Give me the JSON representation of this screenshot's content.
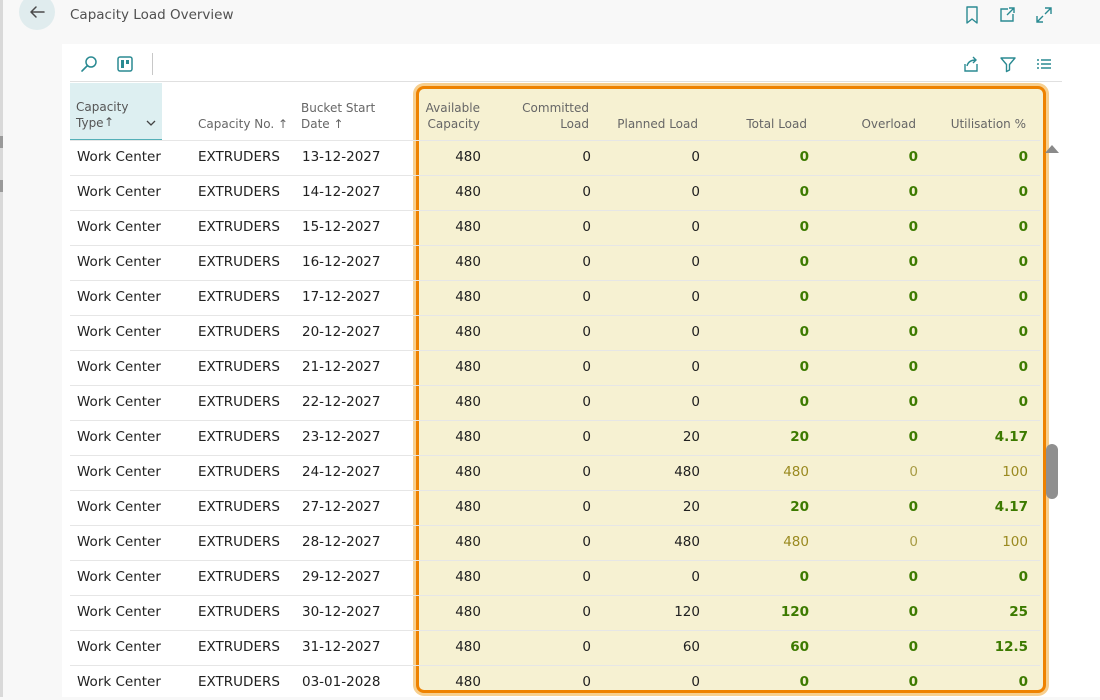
{
  "page": {
    "title": "Capacity Load Overview"
  },
  "header_icons": [
    "back-arrow-icon",
    "bookmark-icon",
    "open-new-window-icon",
    "expand-icon"
  ],
  "toolbar_icons": [
    "search-icon",
    "layout-icon",
    "share-icon",
    "filter-icon",
    "list-icon"
  ],
  "columns": {
    "cap_type": "Capacity Type",
    "cap_type_sort": "↑",
    "cap_no": "Capacity No.",
    "cap_no_sort": "↑",
    "bucket_line1": "Bucket Start",
    "bucket_line2": "Date",
    "bucket_sort": "↑",
    "avail_line1": "Available",
    "avail_line2": "Capacity",
    "comm_line1": "Committed",
    "comm_line2": "Load",
    "planned": "Planned Load",
    "total": "Total Load",
    "overload": "Overload",
    "util": "Utilisation %"
  },
  "rows": [
    {
      "type": "Work Center",
      "no": "EXTRUDERS",
      "date": "13-12-2027",
      "avail": "480",
      "comm": "0",
      "plan": "0",
      "total": "0",
      "over": "0",
      "util": "0",
      "style": "green"
    },
    {
      "type": "Work Center",
      "no": "EXTRUDERS",
      "date": "14-12-2027",
      "avail": "480",
      "comm": "0",
      "plan": "0",
      "total": "0",
      "over": "0",
      "util": "0",
      "style": "green"
    },
    {
      "type": "Work Center",
      "no": "EXTRUDERS",
      "date": "15-12-2027",
      "avail": "480",
      "comm": "0",
      "plan": "0",
      "total": "0",
      "over": "0",
      "util": "0",
      "style": "green"
    },
    {
      "type": "Work Center",
      "no": "EXTRUDERS",
      "date": "16-12-2027",
      "avail": "480",
      "comm": "0",
      "plan": "0",
      "total": "0",
      "over": "0",
      "util": "0",
      "style": "green"
    },
    {
      "type": "Work Center",
      "no": "EXTRUDERS",
      "date": "17-12-2027",
      "avail": "480",
      "comm": "0",
      "plan": "0",
      "total": "0",
      "over": "0",
      "util": "0",
      "style": "green"
    },
    {
      "type": "Work Center",
      "no": "EXTRUDERS",
      "date": "20-12-2027",
      "avail": "480",
      "comm": "0",
      "plan": "0",
      "total": "0",
      "over": "0",
      "util": "0",
      "style": "green"
    },
    {
      "type": "Work Center",
      "no": "EXTRUDERS",
      "date": "21-12-2027",
      "avail": "480",
      "comm": "0",
      "plan": "0",
      "total": "0",
      "over": "0",
      "util": "0",
      "style": "green"
    },
    {
      "type": "Work Center",
      "no": "EXTRUDERS",
      "date": "22-12-2027",
      "avail": "480",
      "comm": "0",
      "plan": "0",
      "total": "0",
      "over": "0",
      "util": "0",
      "style": "green"
    },
    {
      "type": "Work Center",
      "no": "EXTRUDERS",
      "date": "23-12-2027",
      "avail": "480",
      "comm": "0",
      "plan": "20",
      "total": "20",
      "over": "0",
      "util": "4.17",
      "style": "green"
    },
    {
      "type": "Work Center",
      "no": "EXTRUDERS",
      "date": "24-12-2027",
      "avail": "480",
      "comm": "0",
      "plan": "480",
      "total": "480",
      "over": "0",
      "util": "100",
      "style": "olive"
    },
    {
      "type": "Work Center",
      "no": "EXTRUDERS",
      "date": "27-12-2027",
      "avail": "480",
      "comm": "0",
      "plan": "20",
      "total": "20",
      "over": "0",
      "util": "4.17",
      "style": "green"
    },
    {
      "type": "Work Center",
      "no": "EXTRUDERS",
      "date": "28-12-2027",
      "avail": "480",
      "comm": "0",
      "plan": "480",
      "total": "480",
      "over": "0",
      "util": "100",
      "style": "olive"
    },
    {
      "type": "Work Center",
      "no": "EXTRUDERS",
      "date": "29-12-2027",
      "avail": "480",
      "comm": "0",
      "plan": "0",
      "total": "0",
      "over": "0",
      "util": "0",
      "style": "green"
    },
    {
      "type": "Work Center",
      "no": "EXTRUDERS",
      "date": "30-12-2027",
      "avail": "480",
      "comm": "0",
      "plan": "120",
      "total": "120",
      "over": "0",
      "util": "25",
      "style": "green"
    },
    {
      "type": "Work Center",
      "no": "EXTRUDERS",
      "date": "31-12-2027",
      "avail": "480",
      "comm": "0",
      "plan": "60",
      "total": "60",
      "over": "0",
      "util": "12.5",
      "style": "green"
    },
    {
      "type": "Work Center",
      "no": "EXTRUDERS",
      "date": "03-01-2028",
      "avail": "480",
      "comm": "0",
      "plan": "0",
      "total": "0",
      "over": "0",
      "util": "0",
      "style": "green"
    }
  ],
  "colors": {
    "accent": "#54b0b8",
    "highlight_border": "#ee8200",
    "highlight_fill": "#f6f1d2",
    "positive": "#3c7a00",
    "olive": "#9a8a20"
  }
}
